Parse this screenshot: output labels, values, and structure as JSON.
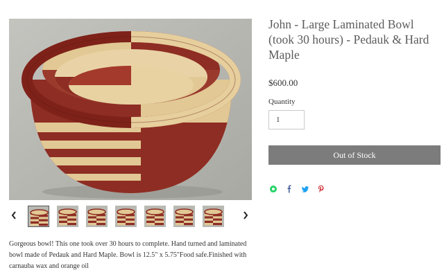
{
  "product": {
    "title": "John - Large Laminated Bowl (took 30 hours) - Pedauk & Hard Maple",
    "price": "$600.00",
    "quantity_label": "Quantity",
    "quantity_value": "1",
    "stock_button_label": "Out of Stock",
    "description": "Gorgeous bowl! This one took over 30 hours to complete. Hand turned and laminated bowl made of Pedauk and Hard Maple. Bowl is 12.5\" x 5.75\"Food safe.Finished with carnauba wax and orange oil"
  },
  "gallery": {
    "prev_label": "‹",
    "next_label": "›",
    "thumbnail_count": 7,
    "active_index": 0
  },
  "share": {
    "icons": [
      "whatsapp-icon",
      "facebook-icon",
      "twitter-icon",
      "pinterest-icon"
    ]
  },
  "colors": {
    "pedauk": "#8e2d23",
    "maple": "#e2c894",
    "background_felt": "#b9b9b3",
    "button": "#7c7c7c",
    "whatsapp": "#25d366",
    "facebook": "#3b5998",
    "twitter": "#1da1f2",
    "pinterest": "#cb2027"
  }
}
